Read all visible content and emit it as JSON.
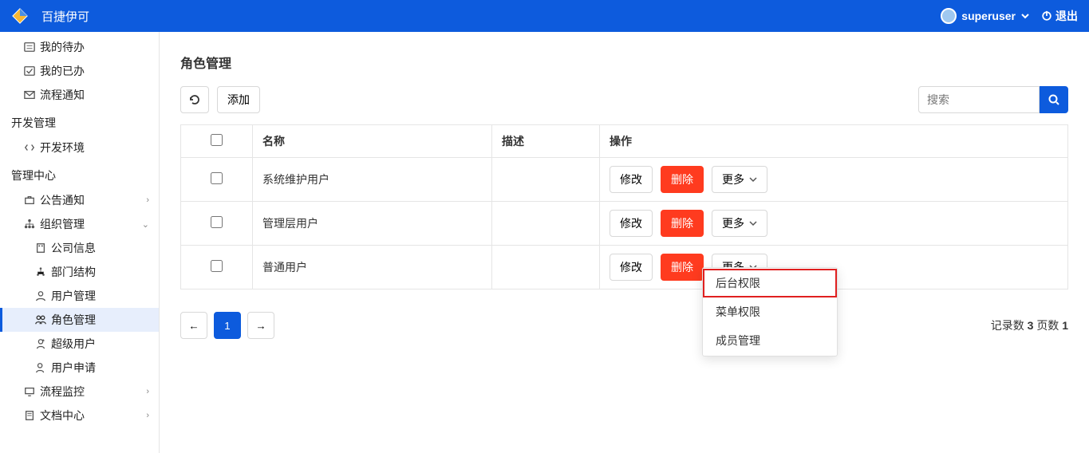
{
  "header": {
    "app_name": "百捷伊可",
    "username": "superuser",
    "logout": "退出"
  },
  "sidebar": {
    "items": [
      {
        "label": "我的待办"
      },
      {
        "label": "我的已办"
      },
      {
        "label": "流程通知"
      }
    ],
    "group_dev": "开发管理",
    "dev_env": "开发环境",
    "group_admin": "管理中心",
    "announce": "公告通知",
    "org": "组织管理",
    "org_children": {
      "company": "公司信息",
      "dept": "部门结构",
      "user": "用户管理",
      "role": "角色管理",
      "super": "超级用户",
      "apply": "用户申请"
    },
    "flow": "流程监控",
    "doc": "文档中心"
  },
  "page": {
    "title": "角色管理",
    "add": "添加",
    "search_placeholder": "搜索",
    "cols": {
      "name": "名称",
      "desc": "描述",
      "ops": "操作"
    },
    "ops": {
      "edit": "修改",
      "del": "删除",
      "more": "更多"
    },
    "rows": [
      {
        "name": "系统维护用户",
        "desc": ""
      },
      {
        "name": "管理层用户",
        "desc": ""
      },
      {
        "name": "普通用户",
        "desc": ""
      }
    ],
    "pager": {
      "prev": "←",
      "current": "1",
      "next": "→",
      "records_label": "记录数",
      "records": "3",
      "pages_label": "页数",
      "pages": "1"
    }
  },
  "dropdown": {
    "backend": "后台权限",
    "menu": "菜单权限",
    "member": "成员管理"
  }
}
